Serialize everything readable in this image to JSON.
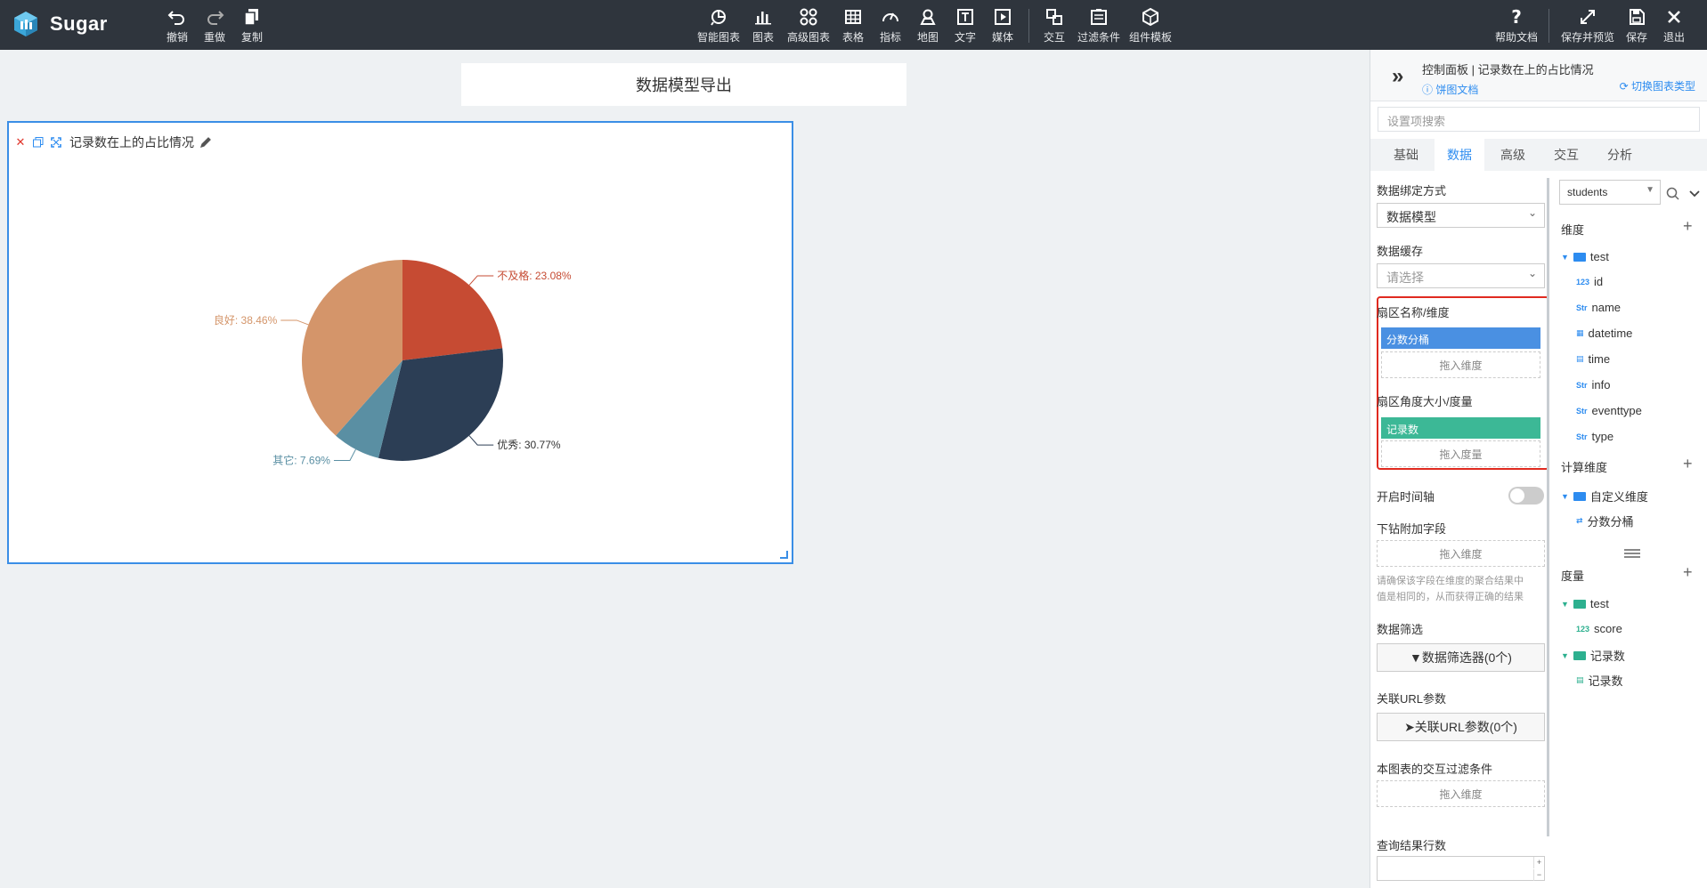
{
  "app": {
    "name": "Sugar"
  },
  "toolbar": {
    "left": [
      {
        "id": "undo",
        "label": "撤销",
        "icon": "undo-icon"
      },
      {
        "id": "redo",
        "label": "重做",
        "icon": "redo-icon"
      },
      {
        "id": "copy",
        "label": "复制",
        "icon": "copy-icon"
      }
    ],
    "center": [
      {
        "id": "smart-chart",
        "label": "智能图表",
        "icon": "smart-chart-icon"
      },
      {
        "id": "chart",
        "label": "图表",
        "icon": "bar-chart-icon"
      },
      {
        "id": "advanced-chart",
        "label": "高级图表",
        "icon": "advanced-chart-icon"
      },
      {
        "id": "table",
        "label": "表格",
        "icon": "table-icon"
      },
      {
        "id": "indicator",
        "label": "指标",
        "icon": "gauge-icon"
      },
      {
        "id": "map",
        "label": "地图",
        "icon": "map-pin-icon"
      },
      {
        "id": "text",
        "label": "文字",
        "icon": "text-icon"
      },
      {
        "id": "media",
        "label": "媒体",
        "icon": "play-icon"
      },
      {
        "id": "interaction",
        "label": "交互",
        "icon": "interaction-icon"
      },
      {
        "id": "filter-condition",
        "label": "过滤条件",
        "icon": "filter-condition-icon"
      },
      {
        "id": "component-template",
        "label": "组件模板",
        "icon": "cube-icon"
      }
    ],
    "right": [
      {
        "id": "help",
        "label": "帮助文档",
        "icon": "help-icon"
      },
      {
        "id": "save-preview",
        "label": "保存并预览",
        "icon": "expand-icon"
      },
      {
        "id": "save",
        "label": "保存",
        "icon": "save-icon"
      },
      {
        "id": "exit",
        "label": "退出",
        "icon": "close-icon"
      }
    ]
  },
  "report": {
    "title": "数据模型导出"
  },
  "chart_card": {
    "title": "记录数在上的占比情况"
  },
  "chart_data": {
    "type": "pie",
    "categories": [
      "不及格",
      "优秀",
      "其它",
      "良好"
    ],
    "values": [
      23.08,
      30.77,
      7.69,
      38.46
    ],
    "labels": [
      "不及格: 23.08%",
      "优秀: 30.77%",
      "其它: 7.69%",
      "良好: 38.46%"
    ],
    "colors": [
      "#c64b33",
      "#2c3e55",
      "#5a8fa3",
      "#d4956a"
    ],
    "unit": "%"
  },
  "panel": {
    "title": "控制面板 | 记录数在上的占比情况",
    "doc_link": "饼图文档",
    "switch_type": "切换图表类型",
    "search_placeholder": "设置项搜索",
    "tabs": [
      "基础",
      "数据",
      "高级",
      "交互",
      "分析"
    ],
    "active_tab": "数据",
    "binding_label": "数据绑定方式",
    "binding_value": "数据模型",
    "cache_label": "数据缓存",
    "cache_placeholder": "请选择",
    "sector_name_label": "扇区名称/维度",
    "sector_name_pill": "分数分桶",
    "drop_dimension": "拖入维度",
    "sector_angle_label": "扇区角度大小/度量",
    "sector_angle_pill": "记录数",
    "drop_measure": "拖入度量",
    "timeline_label": "开启时间轴",
    "drill_label": "下钻附加字段",
    "drill_drop": "拖入维度",
    "drill_hint_1": "请确保该字段在维度的聚合结果中",
    "drill_hint_2": "值是相同的，从而获得正确的结果",
    "filter_label": "数据筛选",
    "filter_button": "数据筛选器(0个)",
    "url_label": "关联URL参数",
    "url_button": "关联URL参数(0个)",
    "interact_filter_label": "本图表的交互过滤条件",
    "interact_filter_drop": "拖入维度",
    "rows_label": "查询结果行数",
    "colors": {
      "accent": "#2d8cf0",
      "dimension_pill": "#4a90e2",
      "measure_pill": "#3cb896",
      "highlight": "#e02a20"
    }
  },
  "fields": {
    "datasource": "students",
    "dimension_header": "维度",
    "dim_folder": "test",
    "dimensions": [
      {
        "type": "123",
        "name": "id"
      },
      {
        "type": "Str",
        "name": "name"
      },
      {
        "type": "date",
        "name": "datetime"
      },
      {
        "type": "cal",
        "name": "time"
      },
      {
        "type": "Str",
        "name": "info"
      },
      {
        "type": "Str",
        "name": "eventtype"
      },
      {
        "type": "Str",
        "name": "type"
      }
    ],
    "calc_header": "计算维度",
    "calc_folder": "自定义维度",
    "calc_item": "分数分桶",
    "measure_header": "度量",
    "measure_folder": "test",
    "measure_item": "score",
    "count_folder": "记录数",
    "count_item": "记录数"
  }
}
